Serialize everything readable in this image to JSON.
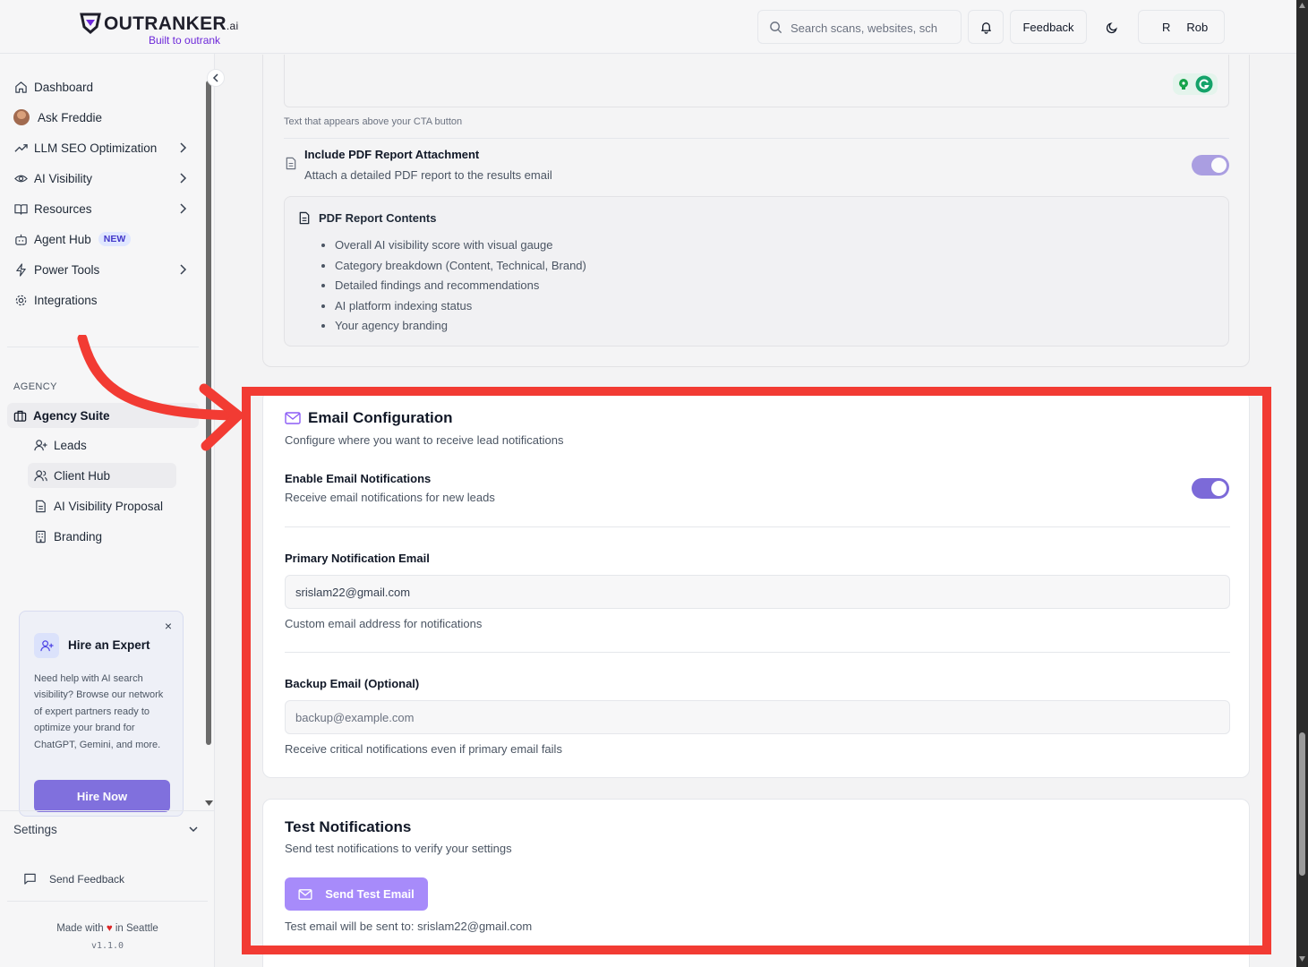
{
  "brand": {
    "name": "OUTRANKER",
    "suffix": ".ai",
    "tagline": "Built to outrank"
  },
  "header": {
    "search_placeholder": "Search scans, websites, sch",
    "feedback_label": "Feedback",
    "user_initial": "R",
    "user_name": "Rob"
  },
  "sidebar": {
    "items": [
      {
        "label": "Dashboard",
        "icon": "home-icon"
      },
      {
        "label": "Ask Freddie",
        "icon": "avatar"
      },
      {
        "label": "LLM SEO Optimization",
        "icon": "trending-up-icon",
        "chevron": true
      },
      {
        "label": "AI Visibility",
        "icon": "eye-icon",
        "chevron": true
      },
      {
        "label": "Resources",
        "icon": "book-icon",
        "chevron": true
      },
      {
        "label": "Agent Hub",
        "icon": "bot-icon",
        "badge": "NEW"
      },
      {
        "label": "Power Tools",
        "icon": "zap-icon",
        "chevron": true
      },
      {
        "label": "Integrations",
        "icon": "gear-icon"
      }
    ],
    "section_label": "AGENCY",
    "agency_suite": "Agency Suite",
    "agency_items": [
      {
        "label": "Leads",
        "icon": "user-plus-icon"
      },
      {
        "label": "Client Hub",
        "icon": "users-icon"
      },
      {
        "label": "AI Visibility Proposal",
        "icon": "file-text-icon"
      },
      {
        "label": "Branding",
        "icon": "building-icon"
      }
    ],
    "expert_card": {
      "title": "Hire an Expert",
      "body": "Need help with AI search visibility? Browse our network of expert partners ready to optimize your brand for ChatGPT, Gemini, and more.",
      "button": "Hire Now",
      "close": "×"
    },
    "settings_label": "Settings",
    "send_feedback": "Send Feedback",
    "made_with_prefix": "Made with",
    "made_with_suffix": "in Seattle",
    "version": "v1.1.0"
  },
  "cta_section": {
    "helper": "Text that appears above your CTA button",
    "pdf_toggle_title": "Include PDF Report Attachment",
    "pdf_toggle_desc": "Attach a detailed PDF report to the results email",
    "pdf_toggle_on": true,
    "pdf_contents_title": "PDF Report Contents",
    "pdf_contents": [
      "Overall AI visibility score with visual gauge",
      "Category breakdown (Content, Technical, Brand)",
      "Detailed findings and recommendations",
      "AI platform indexing status",
      "Your agency branding"
    ]
  },
  "email_config": {
    "title": "Email Configuration",
    "subtitle": "Configure where you want to receive lead notifications",
    "enable_title": "Enable Email Notifications",
    "enable_desc": "Receive email notifications for new leads",
    "enable_on": true,
    "primary_label": "Primary Notification Email",
    "primary_value": "srislam22@gmail.com",
    "primary_help": "Custom email address for notifications",
    "backup_label": "Backup Email (Optional)",
    "backup_placeholder": "backup@example.com",
    "backup_help": "Receive critical notifications even if primary email fails"
  },
  "test_notifications": {
    "title": "Test Notifications",
    "subtitle": "Send test notifications to verify your settings",
    "button": "Send Test Email",
    "note": "Test email will be sent to: srislam22@gmail.com"
  },
  "colors": {
    "accent": "#7c6ad8",
    "highlight": "#f23b33",
    "button_light": "#a78bfa"
  }
}
